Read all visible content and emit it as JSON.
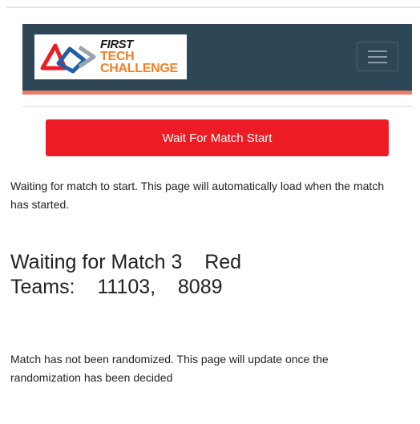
{
  "logo": {
    "line1": "FIRST",
    "line2": "TECH",
    "line3": "CHALLENGE"
  },
  "nav": {
    "menu_icon": "hamburger-menu-icon"
  },
  "button": {
    "label": "Wait For Match Start"
  },
  "waiting_message": {
    "line1": "Waiting for match to start. This page will automatically load when the match",
    "line2": "has started."
  },
  "match": {
    "heading": "Waiting for Match 3    Red",
    "teams": "Teams:    11103,    8089"
  },
  "randomization_message": {
    "line1": "Match has not been randomized. This page will update once the",
    "line2": "randomization has been decided"
  },
  "colors": {
    "navbar": "#2d4757",
    "accent": "#ec7c66",
    "button": "#ed1c24",
    "logo_orange": "#f57e22"
  }
}
